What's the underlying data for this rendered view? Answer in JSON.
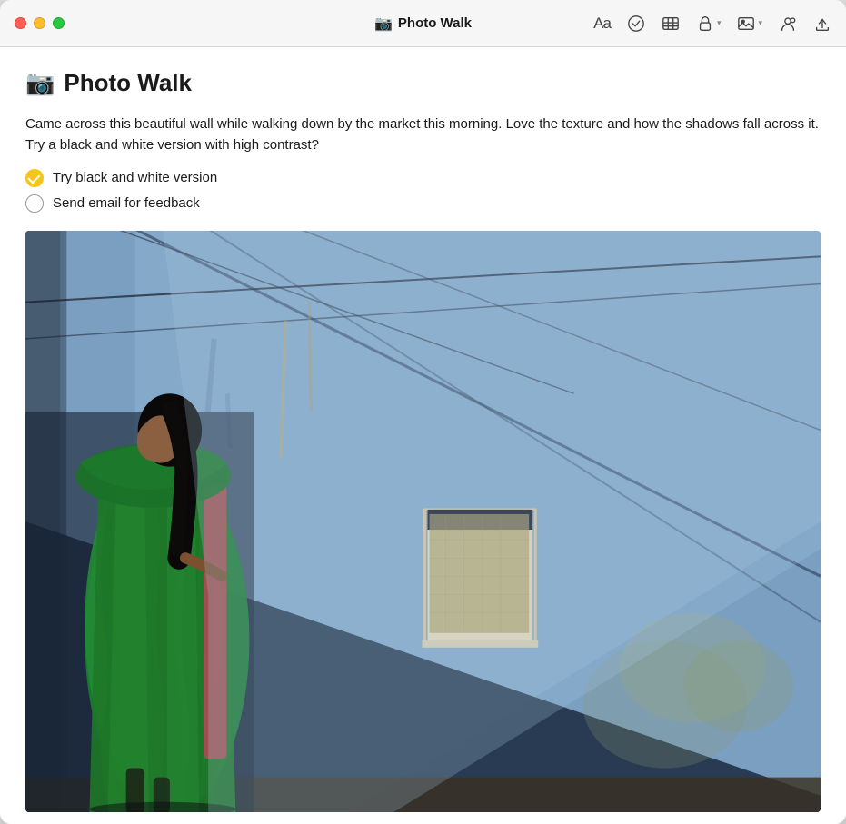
{
  "window": {
    "title": "Photo Walk",
    "icon": "📷"
  },
  "titlebar": {
    "title": "Photo Walk",
    "icon": "📷",
    "tools": {
      "font": "Aa",
      "check_label": "check-icon",
      "table_label": "table-icon",
      "lock_label": "lock-icon",
      "lock_dropdown": "▾",
      "media_label": "media-icon",
      "media_dropdown": "▾",
      "collab_label": "collab-icon",
      "share_label": "share-icon"
    }
  },
  "note": {
    "title": "Photo Walk",
    "icon": "📷",
    "body": "Came across this beautiful wall while walking down by the market this morning. Love the texture and how the shadows fall across it. Try a black and white version with high contrast?",
    "checklist": [
      {
        "id": 1,
        "text": "Try black and white version",
        "checked": true
      },
      {
        "id": 2,
        "text": "Send email for feedback",
        "checked": false
      }
    ],
    "image_alt": "Blue wall with woman in green sari and diagonal shadows"
  },
  "colors": {
    "accent_yellow": "#f5c518",
    "check_unchecked_border": "#999999",
    "title_color": "#1a1a1a",
    "body_color": "#1a1a1a"
  }
}
